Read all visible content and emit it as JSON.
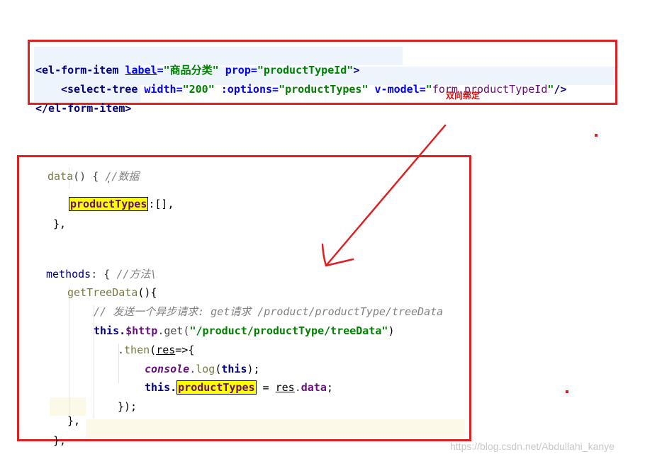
{
  "top": {
    "line1": {
      "open": "<el-form-item",
      "label_attr": "label",
      "eq1": "=",
      "label_val": "\"商品分类\"",
      "prop_attr": "prop",
      "eq2": "=",
      "prop_val": "\"productTypeId\"",
      "close": ">"
    },
    "line2": {
      "open": "<select-tree",
      "width_attr": "width",
      "eq1": "=",
      "width_val": "\"200\"",
      "options_attr": ":options",
      "eq2": "=",
      "options_val": "\"productTypes\"",
      "vmodel_attr": "v-model",
      "eq3": "=",
      "vmodel_val_q1": "\"",
      "vmodel_val": "form.productTypeId",
      "vmodel_val_q2": "\"",
      "close": "/>"
    },
    "line3": {
      "tag": "</el-form-item>"
    },
    "note": "双向绑定"
  },
  "code": {
    "l1_name": "data",
    "l1_rest": "() { ",
    "l1_comment": "//数据",
    "l2_frag": ",",
    "l3_field": "productTypes",
    "l3_rest": ":[],",
    "l4": "},",
    "l5_kw": "methods",
    "l5_rest": ": { ",
    "l5_comment": "//方法\\",
    "l6_fn": "getTreeData",
    "l6_rest": "(){",
    "l7_comment": "// 发送一个异步请求: get请求 /product/productType/treeData",
    "l8_this": "this.",
    "l8_http": "$http",
    "l8_get": ".get(",
    "l8_str": "\"/product/productType/treeData\"",
    "l8_end": ")",
    "l9_dot": ".",
    "l9_then": "then",
    "l9_paren": "(",
    "l9_res": "res",
    "l9_arrow": "=>{",
    "l10_console": "console",
    "l10_dot": ".",
    "l10_log": "log",
    "l10_open": "(",
    "l10_this": "this",
    "l10_close": ");",
    "l11_this": "this.",
    "l11_field": "productTypes",
    "l11_eq": " = ",
    "l11_res": "res",
    "l11_dot": ".",
    "l11_data": "data",
    "l11_semi": ";",
    "l12": "});",
    "l13": "},",
    "l14": "},"
  },
  "watermark": "https://blog.csdn.net/Abdullahi_kanye",
  "colors": {
    "annotation": "#e02020",
    "highlight": "#ffff00"
  }
}
